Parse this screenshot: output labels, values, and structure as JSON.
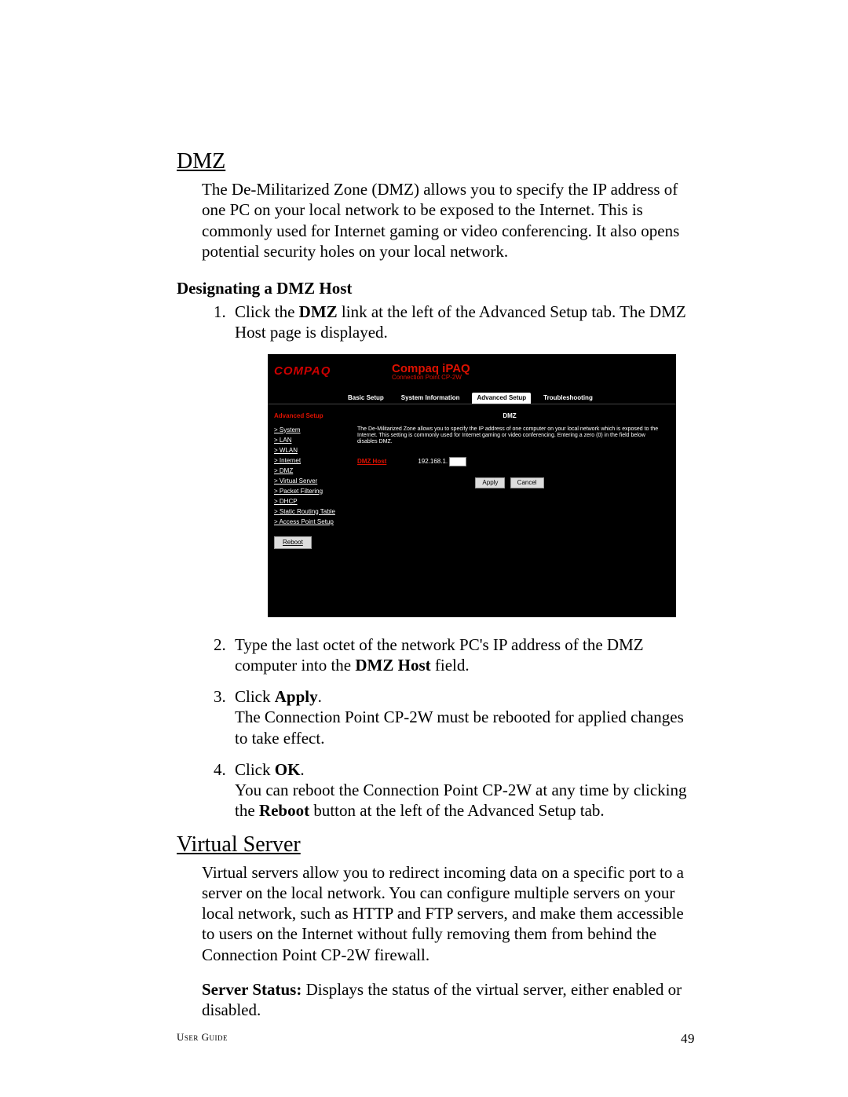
{
  "headings": {
    "dmz": "DMZ",
    "designating": "Designating a DMZ Host",
    "virtual_server": "Virtual Server"
  },
  "paragraphs": {
    "dmz_intro": "The De-Militarized Zone (DMZ) allows you to specify the IP address of one PC on your local network to be exposed to the Internet. This is commonly used for Internet gaming or video conferencing. It also opens potential security holes on your local network.",
    "vs_intro": "Virtual servers allow you to redirect incoming data on a specific port to a server on the local network. You can configure multiple servers on your local network, such as HTTP and FTP servers, and make them accessible to users on the Internet without fully removing them from behind the Connection Point CP-2W firewall.",
    "server_status_label": "Server Status:",
    "server_status_text": " Displays the status of the virtual server, either enabled or disabled."
  },
  "instructions": [
    {
      "pre": "Click the ",
      "bold": "DMZ",
      "post": " link at the left of the Advanced Setup tab. The DMZ Host page is displayed."
    },
    {
      "pre": "Type the last octet of the network PC's IP address of the DMZ computer into the ",
      "bold": "DMZ Host",
      "post": " field."
    },
    {
      "pre": "Click ",
      "bold": "Apply",
      "post": ".",
      "cont": "The Connection Point CP-2W must be rebooted for applied changes to take effect."
    },
    {
      "pre": "Click ",
      "bold": "OK",
      "post": ".",
      "cont_pre": "You can reboot the Connection Point CP-2W at any time by clicking the ",
      "cont_bold": "Reboot",
      "cont_post": " button at the left of the Advanced Setup tab."
    }
  ],
  "screenshot": {
    "brand": "COMPAQ",
    "title": "Compaq iPAQ",
    "subtitle": "Connection Point CP-2W",
    "tabs": [
      "Basic Setup",
      "System Information",
      "Advanced Setup",
      "Troubleshooting"
    ],
    "active_tab_index": 2,
    "sidebar": {
      "heading": "Advanced Setup",
      "items": [
        "System",
        "LAN",
        "WLAN",
        "Internet",
        "DMZ",
        "Virtual Server",
        "Packet Filtering",
        "DHCP",
        "Static Routing Table",
        "Access Point Setup"
      ],
      "reboot": "Reboot"
    },
    "panel": {
      "title": "DMZ",
      "desc": "The De-Militarized Zone allows you to specify the IP address of one computer on your local network which is exposed to the Internet. This setting is commonly used for Internet gaming or video conferencing. Entering a zero (0) in the field below disables DMZ.",
      "host_label": "DMZ Host",
      "ip_prefix": "192.168.1.",
      "apply": "Apply",
      "cancel": "Cancel"
    }
  },
  "footer": {
    "left": "User Guide",
    "page": "49"
  }
}
